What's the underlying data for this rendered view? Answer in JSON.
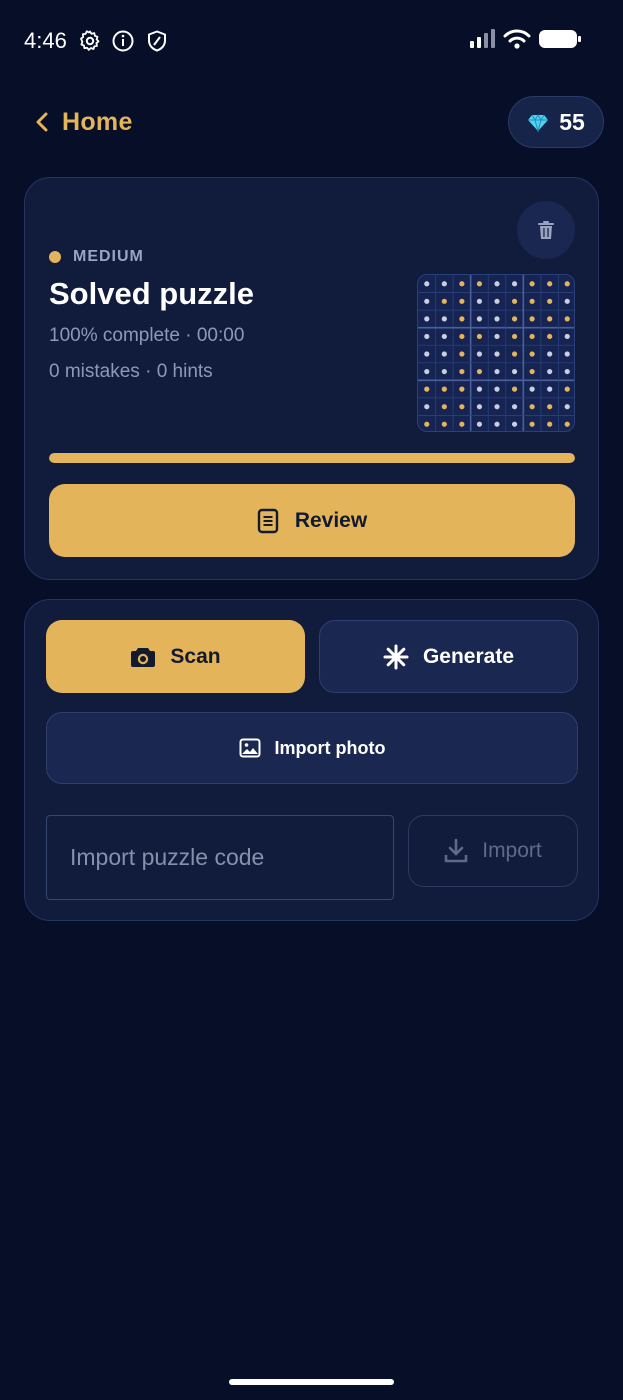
{
  "status_bar": {
    "time": "4:46",
    "icons": [
      "settings-icon",
      "info-icon",
      "shield-icon",
      "signal-icon",
      "wifi-icon",
      "battery-icon"
    ]
  },
  "header": {
    "back_label": "Home",
    "gems_count": "55"
  },
  "current_puzzle": {
    "difficulty": "MEDIUM",
    "title": "Solved puzzle",
    "stats": "100% complete · 00:00",
    "meta": "0 mistakes · 0 hints",
    "progress": 1.0,
    "review_label": "Review"
  },
  "new_puzzle": {
    "scan_label": "Scan",
    "generate_label": "Generate",
    "import_photo_label": "Import photo",
    "code_placeholder": "Import puzzle code",
    "import_label": "Import"
  },
  "colors": {
    "background": "#070f28",
    "card": "#111b3c",
    "accent": "#e4b45a",
    "muted_text": "#8f99b6"
  },
  "thumbnail": {
    "given_color": "#c9cfdc",
    "filled_color": "#e4b45a",
    "cells": [
      "GGFFGGFFF",
      "GFFGGFFFG",
      "GGFGGFFFF",
      "GGFFGFFFG",
      "GGFGGFFGG",
      "GGFFGGFGG",
      "FFFGGFGGF",
      "GFFGGGFFG",
      "FFFGGGFFF"
    ]
  }
}
